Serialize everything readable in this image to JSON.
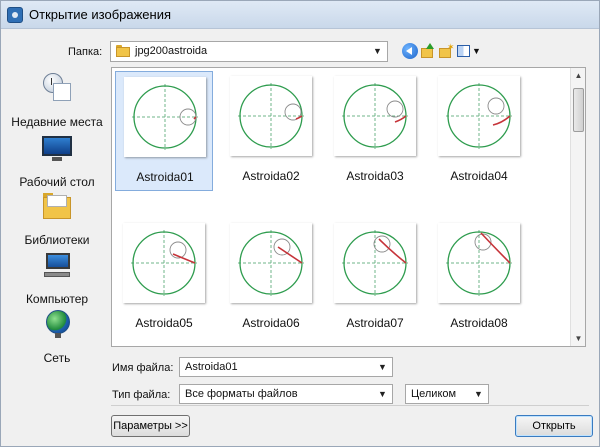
{
  "window": {
    "title": "Открытие изображения"
  },
  "toolbar": {
    "folder_label": "Папка:",
    "folder_value": "jpg200astroida",
    "icons": [
      "back-icon",
      "up-folder-icon",
      "new-folder-icon",
      "view-menu-icon"
    ]
  },
  "places": [
    {
      "label": "Недавние места",
      "icon": "recent-places-icon"
    },
    {
      "label": "Рабочий стол",
      "icon": "desktop-icon"
    },
    {
      "label": "Библиотеки",
      "icon": "libraries-icon"
    },
    {
      "label": "Компьютер",
      "icon": "computer-icon"
    },
    {
      "label": "Сеть",
      "icon": "network-icon"
    }
  ],
  "files": [
    {
      "name": "Astroida01",
      "selected": true
    },
    {
      "name": "Astroida02",
      "selected": false
    },
    {
      "name": "Astroida03",
      "selected": false
    },
    {
      "name": "Astroida04",
      "selected": false
    },
    {
      "name": "Astroida05",
      "selected": false
    },
    {
      "name": "Astroida06",
      "selected": false
    },
    {
      "name": "Astroida07",
      "selected": false
    },
    {
      "name": "Astroida08",
      "selected": false
    }
  ],
  "form": {
    "filename_label": "Имя файла:",
    "filename_value": "Astroida01",
    "filetype_label": "Тип файла:",
    "filetype_value": "Все форматы файлов",
    "mode_value": "Целиком"
  },
  "buttons": {
    "params": "Параметры >>",
    "open": "Открыть"
  },
  "colors": {
    "circle": "#2e9c4e",
    "trace": "#c6343a",
    "selection": "#dbe9fb"
  }
}
